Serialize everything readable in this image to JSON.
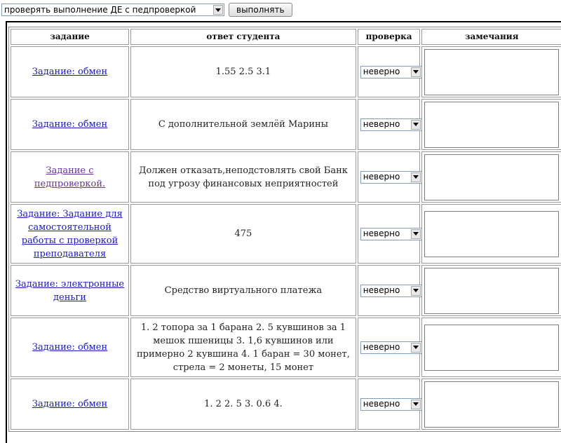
{
  "toolbar": {
    "mode_select_value": "проверять выполнение ДЕ с педпроверкой",
    "run_button_label": "выполнять"
  },
  "table": {
    "headers": {
      "task": "задание",
      "answer": "ответ студента",
      "check": "проверка",
      "remarks": "замечания"
    },
    "rows": [
      {
        "task": "Задание: обмен",
        "answer": "1.55 2.5 3.1",
        "check": "неверно",
        "remarks": ""
      },
      {
        "task": "Задание: обмен",
        "answer": "С дополнительной землёй Марины",
        "check": "неверно",
        "remarks": ""
      },
      {
        "task": "Задание с педпроверкой.",
        "answer": "Должен отказать,неподстовлять свой Банк под угрозу финансовых неприятностей",
        "check": "неверно",
        "remarks": ""
      },
      {
        "task": "Задание: Задание для самостоятельной работы с проверкой преподавателя",
        "answer": "475",
        "check": "неверно",
        "remarks": ""
      },
      {
        "task": "Задание: электронные деньги",
        "answer": "Средство виртуального платежа",
        "check": "неверно",
        "remarks": ""
      },
      {
        "task": "Задание: обмен",
        "answer": "1. 2 топора за 1 барана 2. 5 кувшинов за 1 мешок пшеницы 3. 1,6 кувшинов или примерно 2 кувшина 4. 1 баран = 30 монет, стрела = 2 монеты, 15 монет",
        "check": "неверно",
        "remarks": ""
      },
      {
        "task": "Задание: обмен",
        "answer": "1. 2 2. 5 3. 0.6 4.",
        "check": "неверно",
        "remarks": ""
      }
    ]
  }
}
